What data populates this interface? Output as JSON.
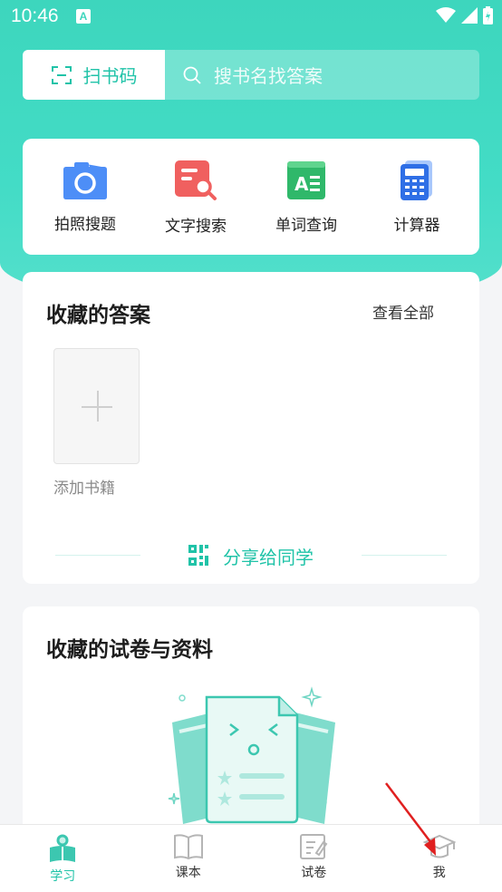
{
  "status": {
    "time": "10:46",
    "notification_badge": "A"
  },
  "search": {
    "scan_label": "扫书码",
    "placeholder": "搜书名找答案"
  },
  "tools": [
    {
      "label": "拍照搜题",
      "icon": "camera-icon"
    },
    {
      "label": "文字搜索",
      "icon": "text-search-icon"
    },
    {
      "label": "单词查询",
      "icon": "word-lookup-icon"
    },
    {
      "label": "计算器",
      "icon": "calculator-icon"
    }
  ],
  "favorites": {
    "title": "收藏的答案",
    "view_all": "查看全部",
    "add_label": "添加书籍",
    "share_label": "分享给同学"
  },
  "papers": {
    "title": "收藏的试卷与资料"
  },
  "tabs": [
    {
      "label": "学习",
      "icon": "study-icon",
      "active": true
    },
    {
      "label": "课本",
      "icon": "textbook-icon",
      "active": false
    },
    {
      "label": "试卷",
      "icon": "exam-icon",
      "active": false
    },
    {
      "label": "我",
      "icon": "profile-icon",
      "active": false
    }
  ],
  "colors": {
    "accent": "#20c3a8",
    "hero": "#43dcc6"
  }
}
